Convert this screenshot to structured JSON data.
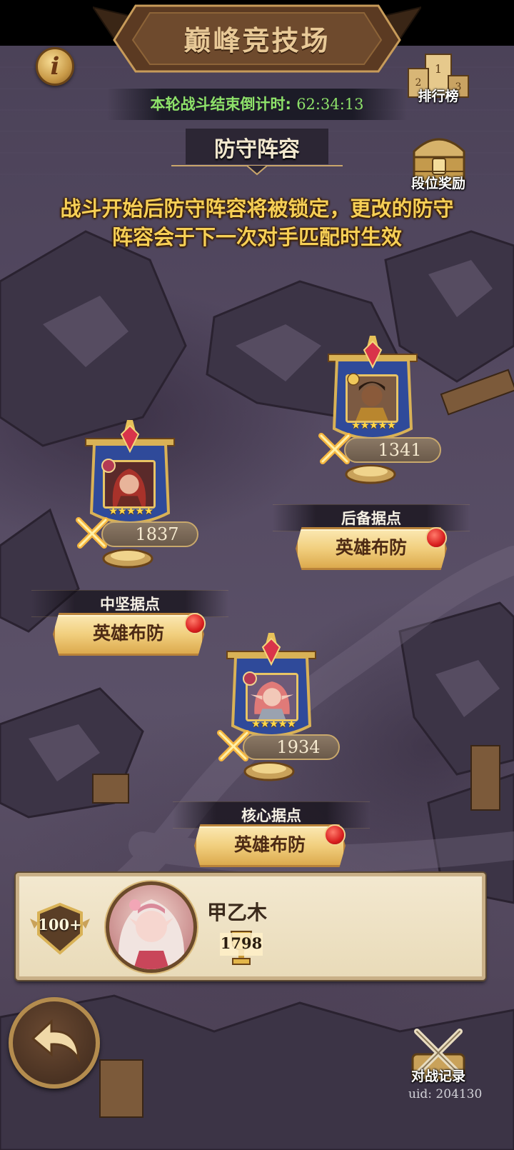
{
  "header": {
    "title": "巅峰竞技场",
    "info_icon": "i",
    "countdown_label": "本轮战斗结束倒计时: ",
    "countdown_value": "62:34:13",
    "ranking_label": "排行榜",
    "rank_reward_label": "段位奖励"
  },
  "defense": {
    "title": "防守阵容",
    "notice_line1": "战斗开始后防守阵容将被锁定，更改的防守",
    "notice_line2": "阵容会于下一次对手匹配时生效"
  },
  "strongholds": [
    {
      "name": "后备据点",
      "power": "1341",
      "button": "英雄布防",
      "stars": "★★★★★",
      "hero": "dark-haired-warrior"
    },
    {
      "name": "中坚据点",
      "power": "1837",
      "button": "英雄布防",
      "stars": "★★★★★",
      "hero": "red-haired-heroine"
    },
    {
      "name": "核心据点",
      "power": "1934",
      "button": "英雄布防",
      "stars": "★★★★★",
      "hero": "pink-haired-elf"
    }
  ],
  "player": {
    "level": "100+",
    "name": "甲乙木",
    "score": "1798"
  },
  "footer": {
    "battle_record_label": "对战记录",
    "uid": "uid: 204130"
  },
  "colors": {
    "accent_gold": "#f6cf56",
    "countdown_green": "#8ee26a",
    "button_gold": "#f1cf7e",
    "banner_blue": "#2f4a9a",
    "alert_red": "#d91f1f"
  }
}
